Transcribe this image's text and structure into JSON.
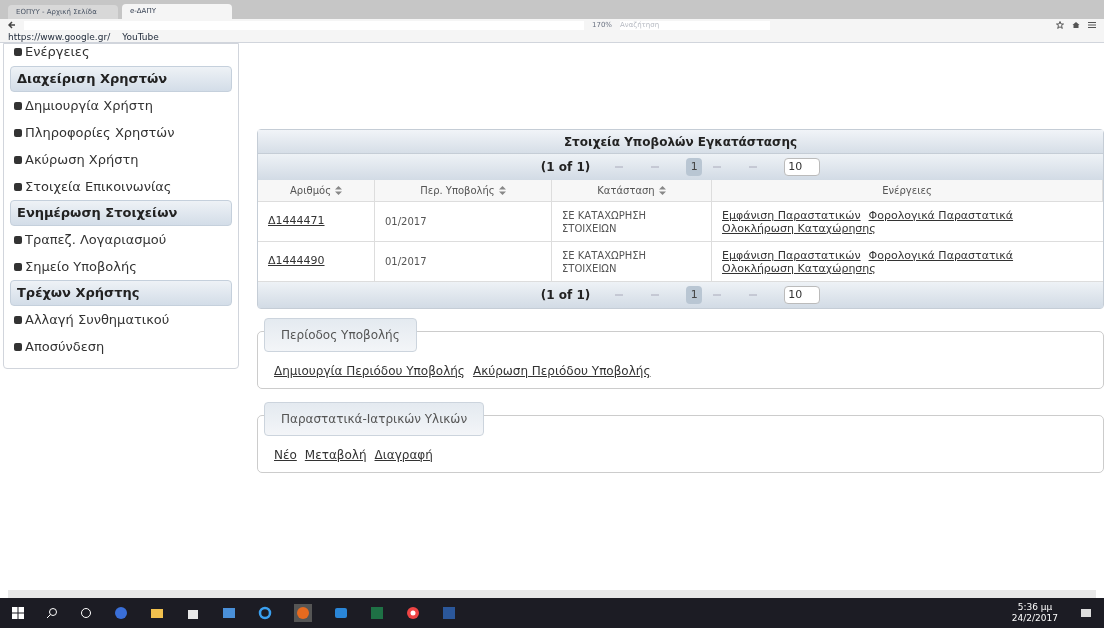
{
  "browser": {
    "tabs": [
      {
        "label": "ΕΟΠΥΥ - Αρχική Σελίδα",
        "selected": false
      },
      {
        "label": "e-ΔΑΠΥ",
        "selected": true
      }
    ],
    "zoom": "170%",
    "search_placeholder": "Αναζήτηση",
    "bookmarks": [
      "https://www.google.gr/",
      "YouTube"
    ]
  },
  "sidebar": {
    "top_item": "Ενέργειες",
    "sections": [
      {
        "title": "Διαχείριση Χρηστών",
        "items": [
          "Δημιουργία Χρήστη",
          "Πληροφορίες Χρηστών",
          "Ακύρωση Χρήστη",
          "Στοιχεία Επικοινωνίας"
        ]
      },
      {
        "title": "Ενημέρωση Στοιχείων",
        "items": [
          "Τραπεζ. Λογαριασμού",
          "Σημείο Υποβολής"
        ]
      },
      {
        "title": "Τρέχων Χρήστης",
        "items": [
          "Αλλαγή Συνθηματικού",
          "Αποσύνδεση"
        ]
      }
    ]
  },
  "table": {
    "title": "Στοιχεία Υποβολών Εγκατάστασης",
    "paginators": [
      {
        "summary": "(1 of 1)",
        "pages": [
          {
            "label": "1",
            "selected": true
          }
        ],
        "page_size": "10"
      },
      {
        "summary": "(1 of 1)",
        "pages": [
          {
            "label": "1",
            "selected": true
          }
        ],
        "page_size": "10"
      }
    ],
    "columns": [
      {
        "label": "Αριθμός",
        "sortable": true
      },
      {
        "label": "Περ. Υποβολής",
        "sortable": true
      },
      {
        "label": "Κατάσταση",
        "sortable": true
      },
      {
        "label": "Ενέργειες",
        "sortable": false
      }
    ],
    "rows": [
      {
        "number": "Δ1444471",
        "period": "01/2017",
        "status": "ΣΕ ΚΑΤΑΧΩΡΗΣΗ ΣΤΟΙΧΕΙΩΝ",
        "actions": [
          "Εμφάνιση Παραστατικών",
          "Φορολογικά Παραστατικά",
          "Ολοκλήρωση Καταχώρησης"
        ]
      },
      {
        "number": "Δ1444490",
        "period": "01/2017",
        "status": "ΣΕ ΚΑΤΑΧΩΡΗΣΗ ΣΤΟΙΧΕΙΩΝ",
        "actions": [
          "Εμφάνιση Παραστατικών",
          "Φορολογικά Παραστατικά",
          "Ολοκλήρωση Καταχώρησης"
        ]
      }
    ]
  },
  "fieldsets": [
    {
      "legend": "Περίοδος Υποβολής",
      "links": [
        "Δημιουργία Περιόδου Υποβολής",
        "Ακύρωση Περιόδου Υποβολής"
      ]
    },
    {
      "legend": "Παραστατικά-Ιατρικών Υλικών",
      "links": [
        "Νέο",
        "Μεταβολή",
        "Διαγραφή"
      ]
    }
  ],
  "taskbar": {
    "time": "5:36 μμ",
    "date": "24/2/2017"
  }
}
